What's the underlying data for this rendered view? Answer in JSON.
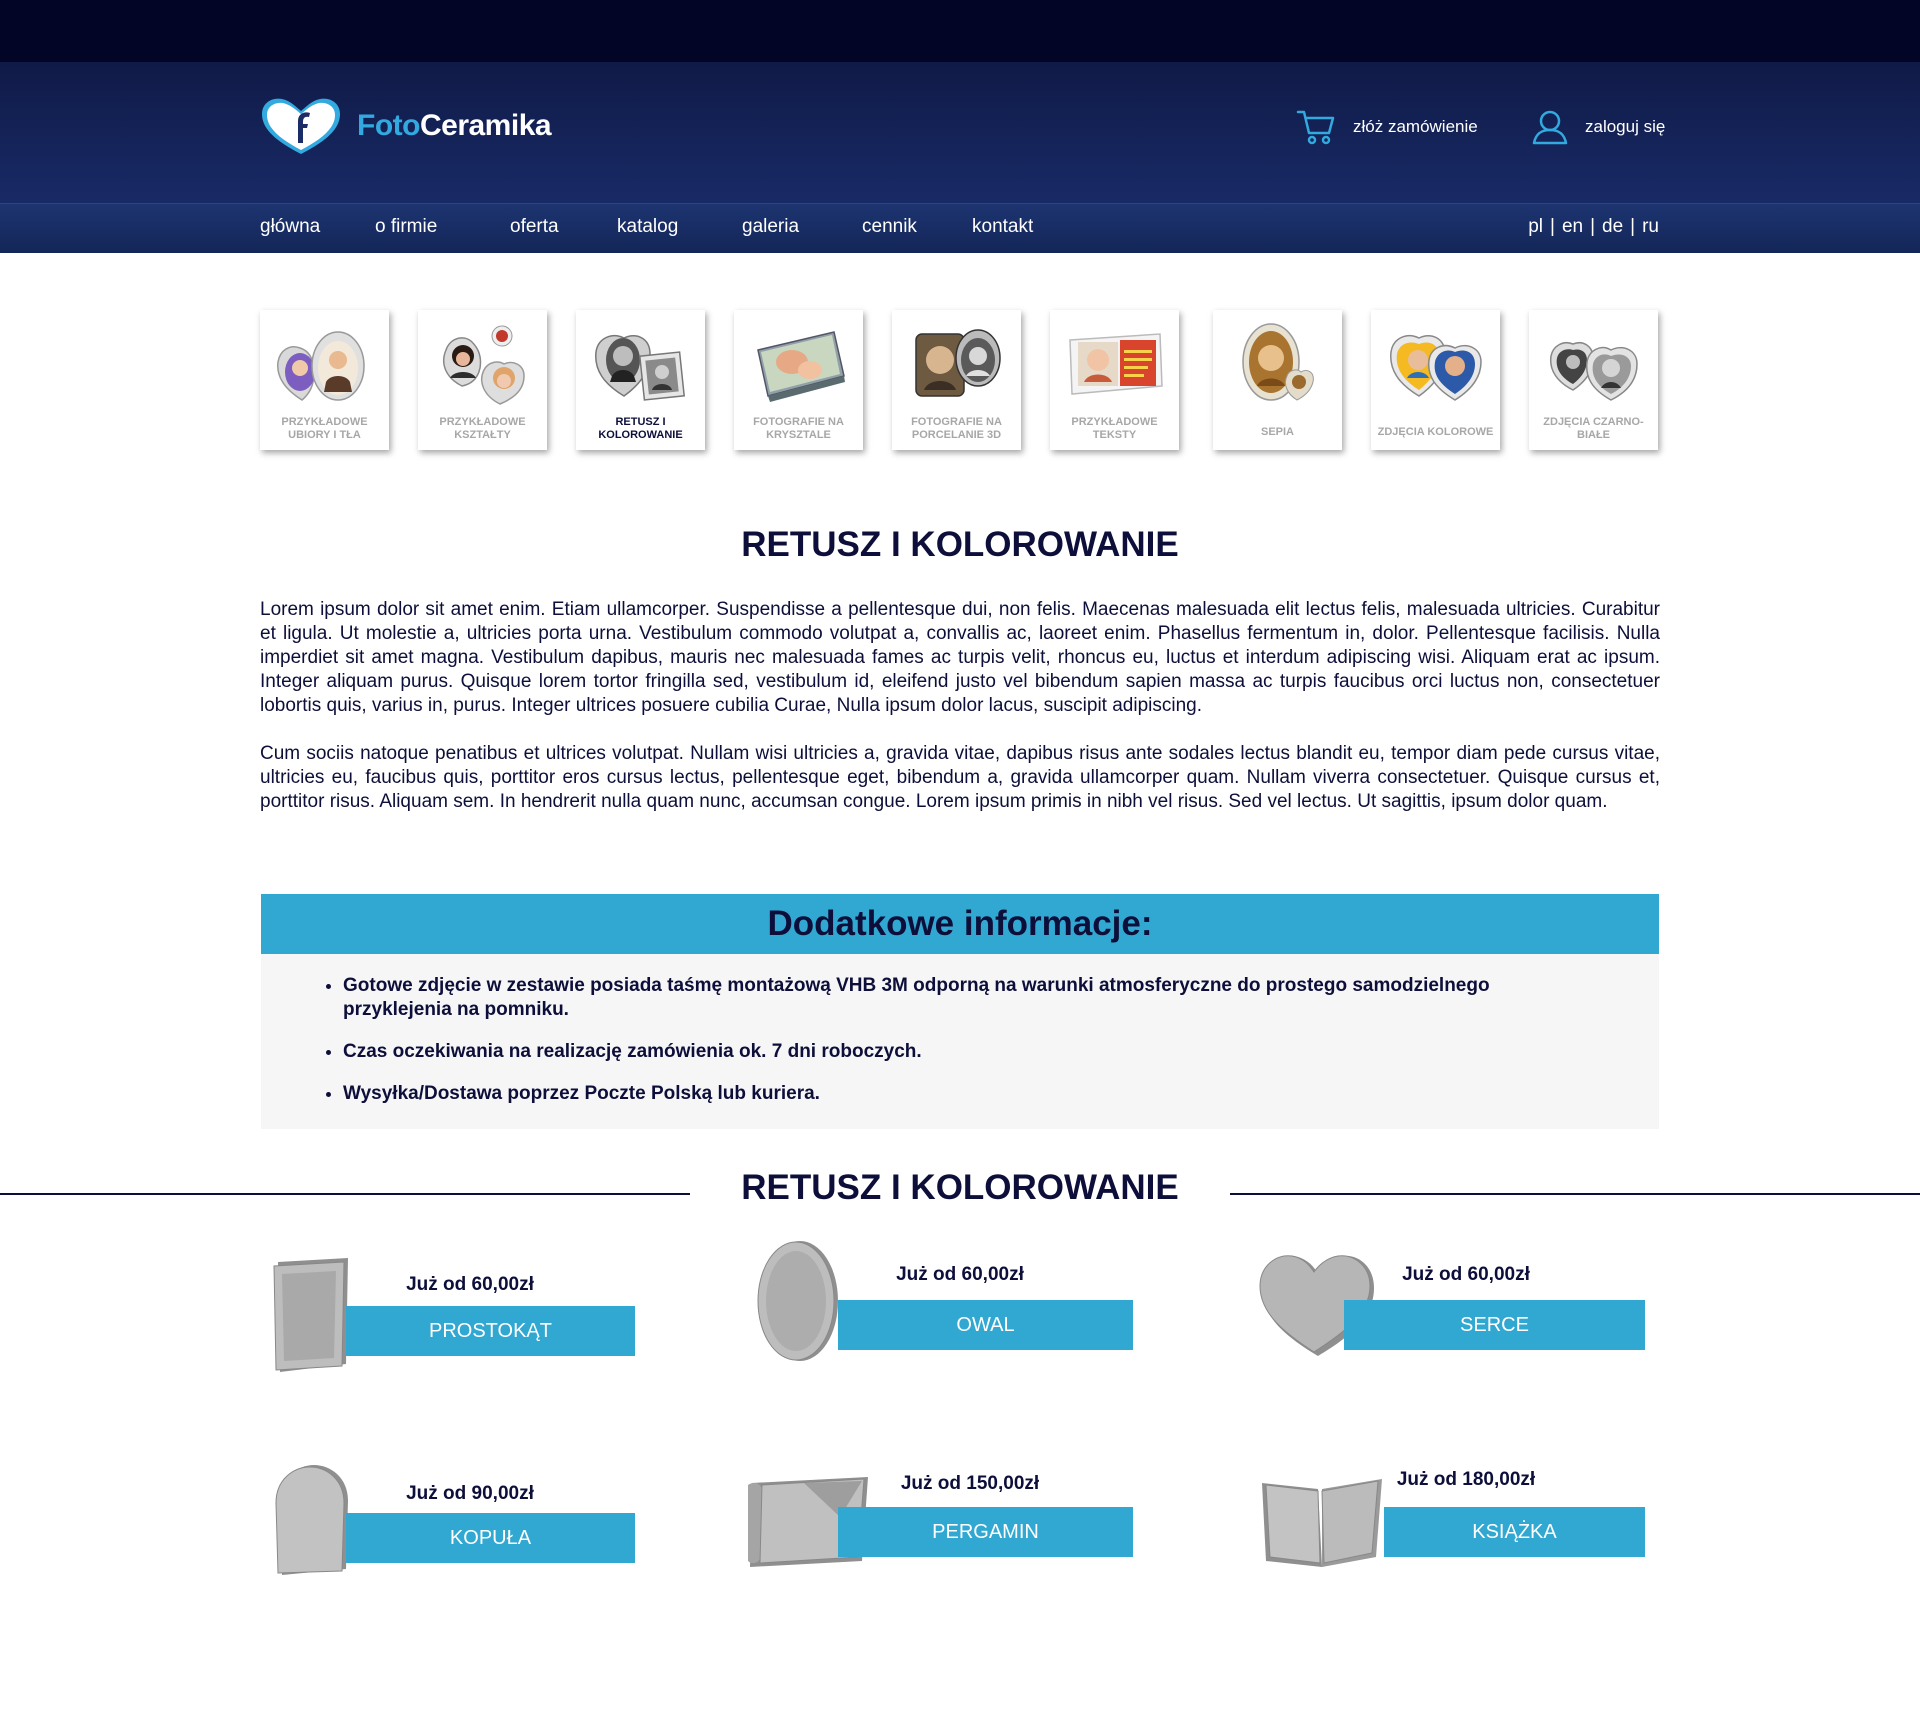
{
  "header": {
    "logo_part1": "Foto",
    "logo_part2": "Ceramika",
    "order_label": "złóż zamówienie",
    "login_label": "zaloguj się"
  },
  "nav": {
    "items": [
      "główna",
      "o firmie",
      "oferta",
      "katalog",
      "galeria",
      "cennik",
      "kontakt"
    ],
    "langs": [
      "pl",
      "en",
      "de",
      "ru"
    ],
    "separator": "|"
  },
  "thumbs": [
    {
      "caption": "PRZYKŁADOWE UBIORY I TŁA"
    },
    {
      "caption": "PRZYKŁADOWE KSZTAŁTY"
    },
    {
      "caption": "RETUSZ I KOLOROWANIE"
    },
    {
      "caption": "FOTOGRAFIE NA KRYSZTALE"
    },
    {
      "caption": "FOTOGRAFIE NA PORCELANIE 3D"
    },
    {
      "caption": "PRZYKŁADOWE TEKSTY"
    },
    {
      "caption": "SEPIA"
    },
    {
      "caption": "ZDJĘCIA KOLOROWE"
    },
    {
      "caption": "ZDJĘCIA CZARNO-BIAŁE"
    }
  ],
  "content": {
    "title": "RETUSZ I KOLOROWANIE",
    "paragraph1": "Lorem ipsum dolor sit amet enim. Etiam ullamcorper. Suspendisse a pellentesque dui, non felis. Maecenas malesuada elit lectus felis, malesuada ultricies. Curabitur et ligula. Ut molestie a, ultricies porta urna. Vestibulum commodo volutpat a, convallis ac, laoreet enim. Phasellus fermentum in, dolor. Pellentesque facilisis. Nulla imperdiet sit amet magna. Vestibulum dapibus, mauris nec malesuada fames ac turpis velit, rhoncus eu, luctus et interdum adipiscing wisi. Aliquam erat ac ipsum. Integer aliquam purus. Quisque lorem tortor fringilla sed, vestibulum id, eleifend justo vel bibendum sapien massa ac turpis faucibus orci luctus non, consectetuer lobortis quis, varius in, purus. Integer ultrices posuere cubilia Curae, Nulla ipsum dolor lacus, suscipit adipiscing.",
    "paragraph2": "Cum sociis natoque penatibus et ultrices volutpat. Nullam wisi ultricies a, gravida vitae, dapibus risus ante sodales lectus blandit eu, tempor diam pede cursus vitae, ultricies eu, faucibus quis, porttitor eros cursus lectus, pellentesque eget, bibendum a, gravida ullamcorper quam. Nullam viverra consectetuer. Quisque cursus et, porttitor risus. Aliquam sem. In hendrerit nulla quam nunc, accumsan congue. Lorem ipsum primis in nibh vel risus. Sed vel lectus. Ut sagittis, ipsum dolor quam."
  },
  "info": {
    "title": "Dodatkowe informacje:",
    "items": [
      "Gotowe zdjęcie w zestawie posiada taśmę montażową VHB 3M odporną na warunki atmosferyczne do prostego samodzielnego przyklejenia na pomniku.",
      "Czas oczekiwania na realizację zamówienia ok. 7 dni roboczych.",
      "Wysyłka/Dostawa poprzez Poczte Polską lub kuriera."
    ]
  },
  "products": {
    "title": "RETUSZ I KOLOROWANIE",
    "items": [
      {
        "price": "Już od 60,00zł",
        "name": "PROSTOKĄT"
      },
      {
        "price": "Już od 60,00zł",
        "name": "OWAL"
      },
      {
        "price": "Już od 60,00zł",
        "name": "SERCE"
      },
      {
        "price": "Już od 90,00zł",
        "name": "KOPUŁA"
      },
      {
        "price": "Już od 150,00zł",
        "name": "PERGAMIN"
      },
      {
        "price": "Już od 180,00zł",
        "name": "KSIĄŻKA"
      }
    ]
  },
  "colors": {
    "dark_navy": "#020526",
    "header_blue": "#182a66",
    "accent_blue": "#31a8d1",
    "text_dark": "#0d0f3a"
  },
  "icons": [
    "logo-heart-icon",
    "cart-icon",
    "user-icon"
  ]
}
